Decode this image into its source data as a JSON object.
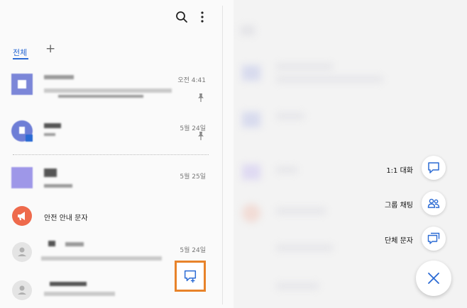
{
  "tabs": {
    "all_label": "전체",
    "add_label": "+"
  },
  "conversations": [
    {
      "time": "오전 4:41",
      "pinned": true
    },
    {
      "time": "5월 24일",
      "pinned": true
    },
    {
      "time": "5월 25일",
      "pinned": false
    },
    {
      "name": "안전 안내 문자"
    },
    {
      "time": "5월 24일",
      "pinned": false
    }
  ],
  "fab_menu": {
    "one_to_one": "1:1 대화",
    "group_chat": "그룹 채팅",
    "broadcast": "단체 문자"
  },
  "colors": {
    "accent": "#2a6ad4",
    "highlight": "#e8832a",
    "safety": "#ee6a4c"
  },
  "icons": [
    "search-icon",
    "more-vert-icon",
    "pin-icon",
    "megaphone-icon",
    "person-icon",
    "new-chat-icon",
    "chat-bubble-icon",
    "group-icon",
    "broadcast-icon",
    "close-icon"
  ]
}
